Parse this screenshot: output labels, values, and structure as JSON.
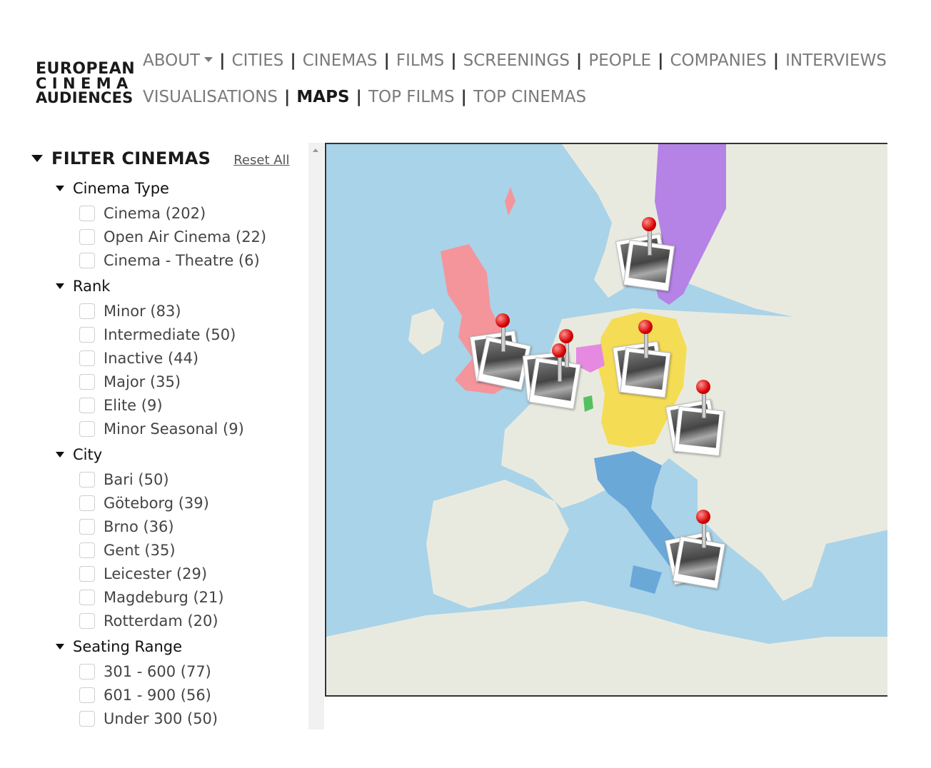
{
  "logo": {
    "line1": "EUROPEAN",
    "line2": "CINEMA",
    "line3": "AUDIENCES"
  },
  "nav": {
    "row1": [
      "ABOUT",
      "CITIES",
      "CINEMAS",
      "FILMS",
      "SCREENINGS",
      "PEOPLE",
      "COMPANIES",
      "INTERVIEWS"
    ],
    "row2": [
      "VISUALISATIONS",
      "MAPS",
      "TOP FILMS",
      "TOP CINEMAS"
    ],
    "active": "MAPS"
  },
  "filter": {
    "title": "FILTER CINEMAS",
    "reset": "Reset All",
    "groups": [
      {
        "title": "Cinema Type",
        "options": [
          "Cinema (202)",
          "Open Air Cinema (22)",
          "Cinema - Theatre (6)"
        ]
      },
      {
        "title": "Rank",
        "options": [
          "Minor (83)",
          "Intermediate (50)",
          "Inactive (44)",
          "Major (35)",
          "Elite (9)",
          "Minor Seasonal (9)"
        ]
      },
      {
        "title": "City",
        "options": [
          "Bari (50)",
          "Göteborg (39)",
          "Brno (36)",
          "Gent (35)",
          "Leicester (29)",
          "Magdeburg (21)",
          "Rotterdam (20)"
        ]
      },
      {
        "title": "Seating Range",
        "options": [
          "301 - 600 (77)",
          "601 - 900 (56)",
          "Under 300 (50)"
        ]
      }
    ]
  },
  "colors": {
    "sea": "#a9d3e8",
    "land": "#e9eadf",
    "uk": "#f4959b",
    "sweden": "#b582e6",
    "germany": "#f5dc55",
    "italy": "#6aa8d8",
    "belgium": "#e58ae0",
    "pin": "#d40000"
  }
}
